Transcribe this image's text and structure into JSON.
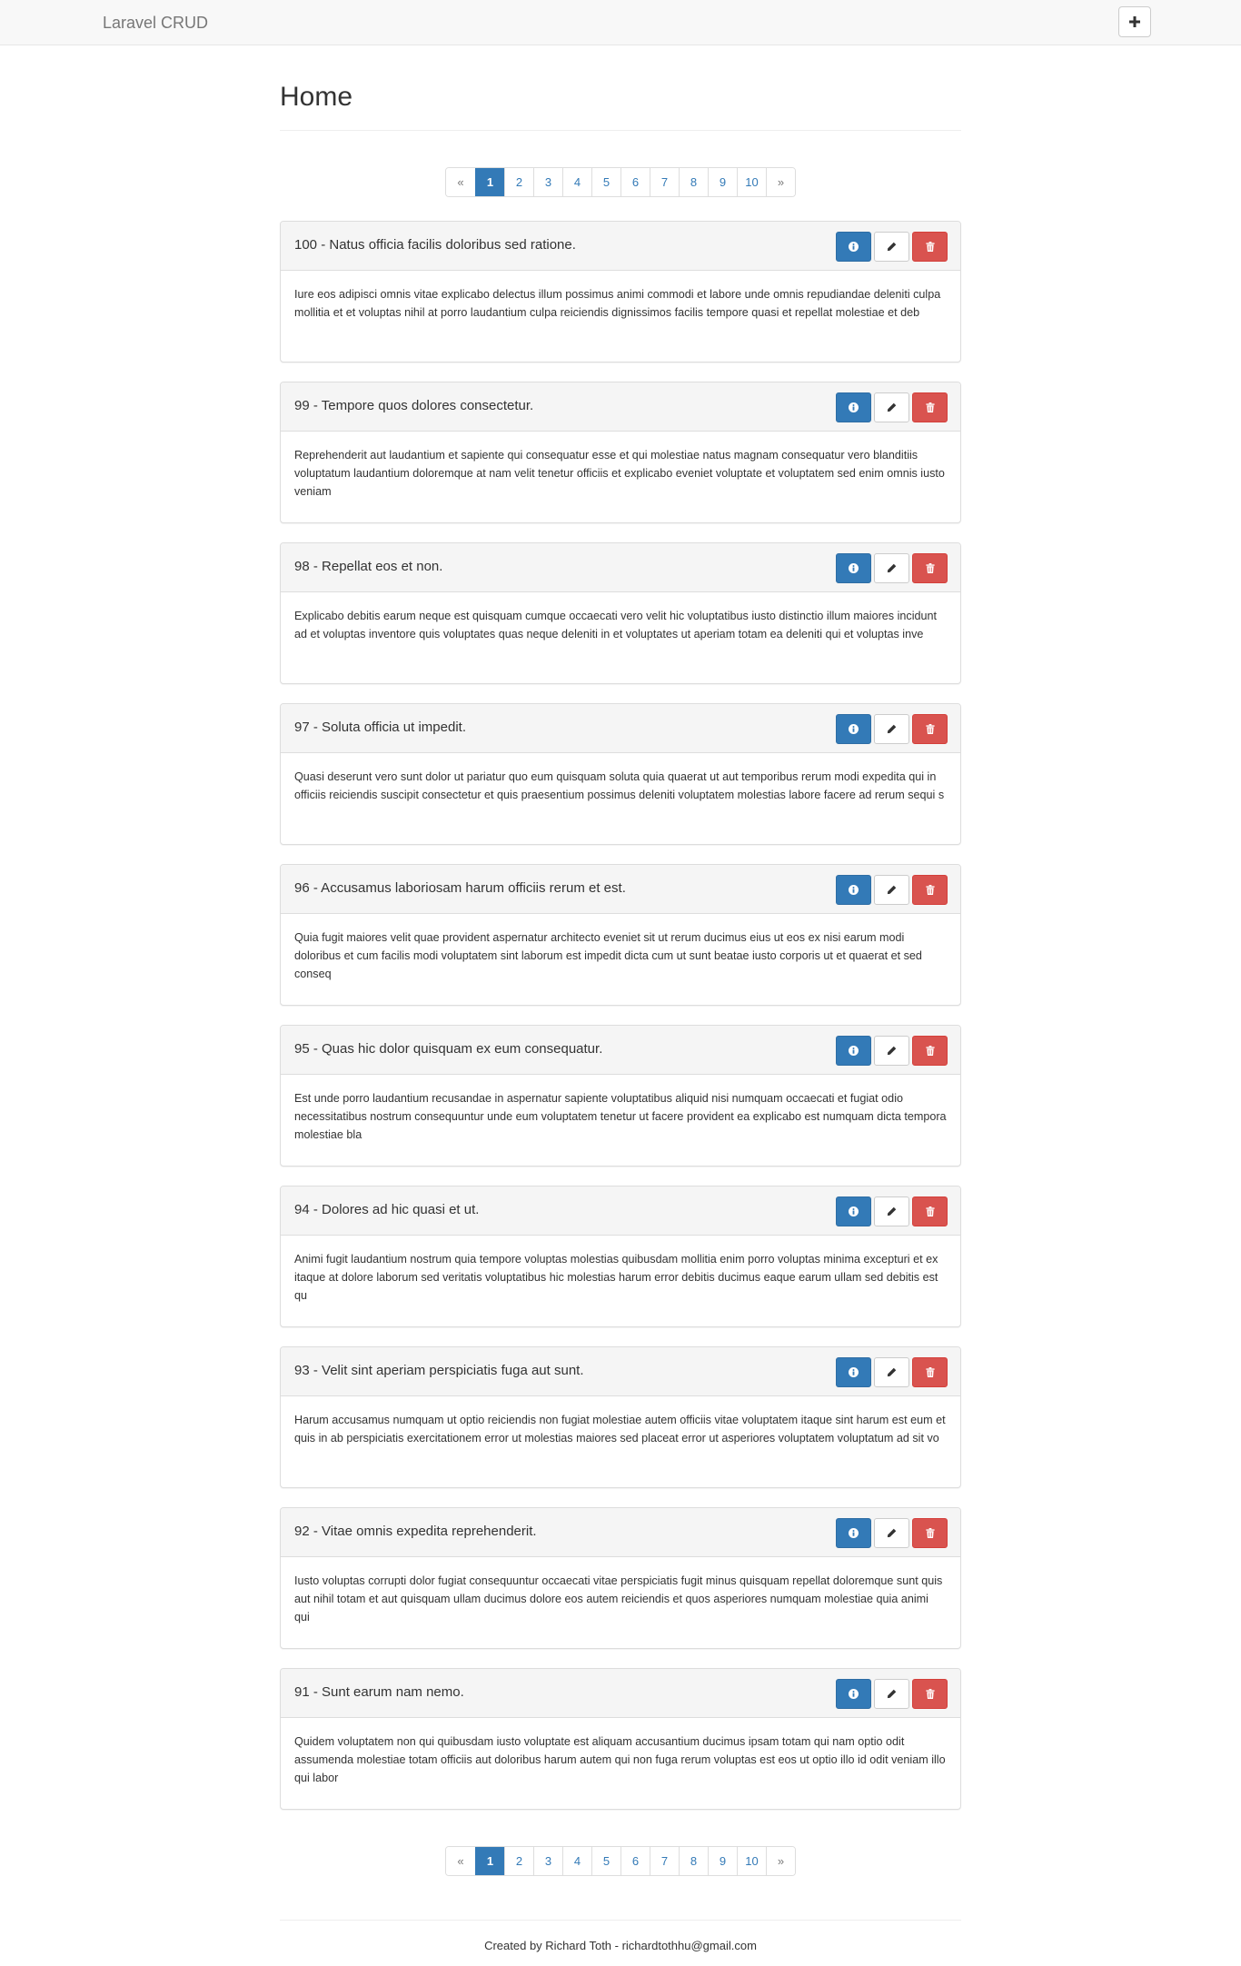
{
  "navbar": {
    "brand": "Laravel CRUD",
    "add_icon": "plus-icon"
  },
  "page": {
    "title": "Home"
  },
  "pagination": {
    "prev": "«",
    "next": "»",
    "pages": [
      "1",
      "2",
      "3",
      "4",
      "5",
      "6",
      "7",
      "8",
      "9",
      "10"
    ],
    "active": "1"
  },
  "posts": [
    {
      "title": "100 - Natus officia facilis doloribus sed ratione.",
      "body": "Iure eos adipisci omnis vitae explicabo delectus illum possimus animi commodi et labore unde omnis repudiandae deleniti culpa mollitia et et voluptas nihil at porro laudantium culpa reiciendis dignissimos facilis tempore quasi et repellat molestiae et deb"
    },
    {
      "title": "99 - Tempore quos dolores consectetur.",
      "body": "Reprehenderit aut laudantium et sapiente qui consequatur esse et qui molestiae natus magnam consequatur vero blanditiis voluptatum laudantium doloremque at nam velit tenetur officiis et explicabo eveniet voluptate et voluptatem sed enim omnis iusto veniam"
    },
    {
      "title": "98 - Repellat eos et non.",
      "body": "Explicabo debitis earum neque est quisquam cumque occaecati vero velit hic voluptatibus iusto distinctio illum maiores incidunt ad et voluptas inventore quis voluptates quas neque deleniti in et voluptates ut aperiam totam ea deleniti qui et voluptas inve"
    },
    {
      "title": "97 - Soluta officia ut impedit.",
      "body": "Quasi deserunt vero sunt dolor ut pariatur quo eum quisquam soluta quia quaerat ut aut temporibus rerum modi expedita qui in officiis reiciendis suscipit consectetur et quis praesentium possimus deleniti voluptatem molestias labore facere ad rerum sequi s"
    },
    {
      "title": "96 - Accusamus laboriosam harum officiis rerum et est.",
      "body": "Quia fugit maiores velit quae provident aspernatur architecto eveniet sit ut rerum ducimus eius ut eos ex nisi earum modi doloribus et cum facilis modi voluptatem sint laborum est impedit dicta cum ut sunt beatae iusto corporis ut et quaerat et sed conseq"
    },
    {
      "title": "95 - Quas hic dolor quisquam ex eum consequatur.",
      "body": "Est unde porro laudantium recusandae in aspernatur sapiente voluptatibus aliquid nisi numquam occaecati et fugiat odio necessitatibus nostrum consequuntur unde eum voluptatem tenetur ut facere provident ea explicabo est numquam dicta tempora molestiae bla"
    },
    {
      "title": "94 - Dolores ad hic quasi et ut.",
      "body": "Animi fugit laudantium nostrum quia tempore voluptas molestias quibusdam mollitia enim porro voluptas minima excepturi et ex itaque at dolore laborum sed veritatis voluptatibus hic molestias harum error debitis ducimus eaque earum ullam sed debitis est qu"
    },
    {
      "title": "93 - Velit sint aperiam perspiciatis fuga aut sunt.",
      "body": "Harum accusamus numquam ut optio reiciendis non fugiat molestiae autem officiis vitae voluptatem itaque sint harum est eum et quis in ab perspiciatis exercitationem error ut molestias maiores sed placeat error ut asperiores voluptatem voluptatum ad sit vo"
    },
    {
      "title": "92 - Vitae omnis expedita reprehenderit.",
      "body": "Iusto voluptas corrupti dolor fugiat consequuntur occaecati vitae perspiciatis fugit minus quisquam repellat doloremque sunt quis aut nihil totam et aut quisquam ullam ducimus dolore eos autem reiciendis et quos asperiores numquam molestiae quia animi qui"
    },
    {
      "title": "91 - Sunt earum nam nemo.",
      "body": "Quidem voluptatem non qui quibusdam iusto voluptate est aliquam accusantium ducimus ipsam totam qui nam optio odit assumenda molestiae totam officiis aut doloribus harum autem qui non fuga rerum voluptas est eos ut optio illo id odit veniam illo qui labor"
    }
  ],
  "actions": {
    "info_icon": "info-icon",
    "edit_icon": "pencil-icon",
    "delete_icon": "trash-icon"
  },
  "colors": {
    "primary": "#337ab7",
    "danger": "#d9534f",
    "navbar_bg": "#f8f8f8"
  },
  "footer": {
    "text": "Created by Richard Toth - richardtothhu@gmail.com"
  }
}
